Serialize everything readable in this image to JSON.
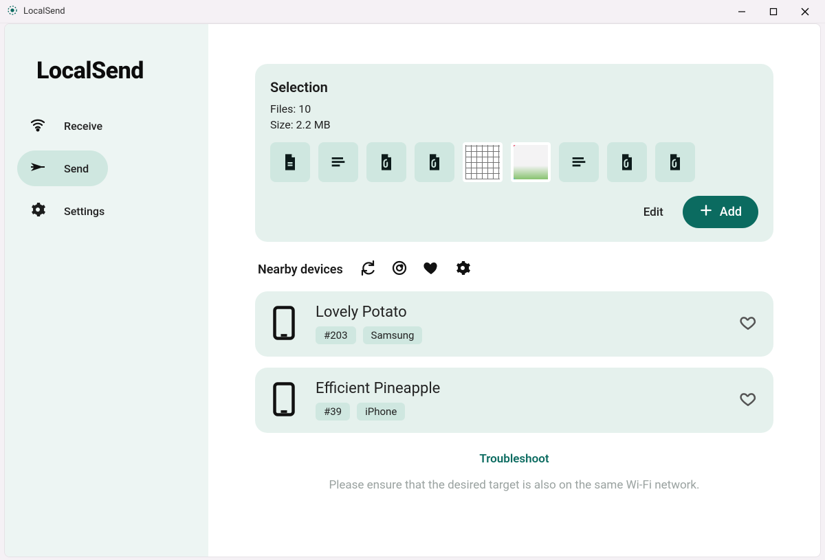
{
  "window": {
    "title": "LocalSend"
  },
  "app": {
    "name": "LocalSend"
  },
  "sidebar": {
    "items": [
      {
        "label": "Receive",
        "icon": "wifi",
        "active": false
      },
      {
        "label": "Send",
        "icon": "send",
        "active": true
      },
      {
        "label": "Settings",
        "icon": "gear",
        "active": false
      }
    ]
  },
  "selection": {
    "title": "Selection",
    "files_label": "Files:",
    "files_count": 10,
    "size_label": "Size:",
    "size_value": "2.2 MB",
    "edit_label": "Edit",
    "add_label": "Add",
    "thumbs": [
      {
        "kind": "doc"
      },
      {
        "kind": "text"
      },
      {
        "kind": "attach"
      },
      {
        "kind": "attach"
      },
      {
        "kind": "image_bw"
      },
      {
        "kind": "image_color"
      },
      {
        "kind": "text"
      },
      {
        "kind": "attach"
      },
      {
        "kind": "attach"
      }
    ]
  },
  "nearby": {
    "label": "Nearby devices"
  },
  "devices": [
    {
      "name": "Lovely Potato",
      "id_tag": "#203",
      "model_tag": "Samsung"
    },
    {
      "name": "Efficient Pineapple",
      "id_tag": "#39",
      "model_tag": "iPhone"
    }
  ],
  "footer": {
    "troubleshoot": "Troubleshoot",
    "help_text": "Please ensure that the desired target is also on the same Wi-Fi network."
  }
}
